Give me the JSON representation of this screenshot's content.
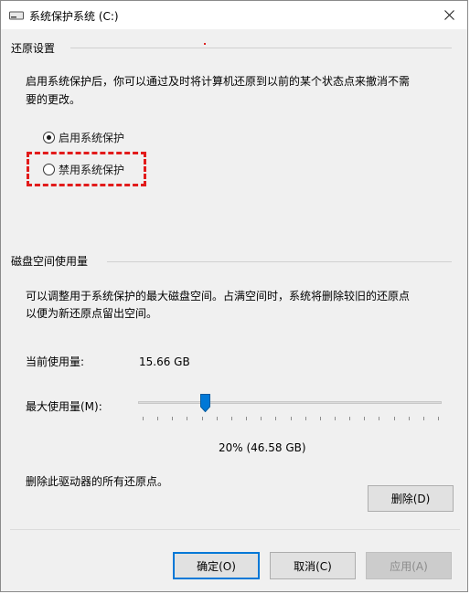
{
  "window": {
    "title": "系统保护系统 (C:)"
  },
  "restore_settings": {
    "group_label": "还原设置",
    "description_line1": "启用系统保护后，你可以通过及时将计算机还原到以前的某个状态点来撤消不需",
    "description_line2": "要的更改。",
    "options": [
      {
        "label": "启用系统保护",
        "selected": true
      },
      {
        "label": "禁用系统保护",
        "selected": false
      }
    ]
  },
  "disk_usage": {
    "group_label": "磁盘空间使用量",
    "description_line1": "可以调整用于系统保护的最大磁盘空间。占满空间时，系统将删除较旧的还原点",
    "description_line2": "以便为新还原点留出空间。",
    "current_label": "当前使用量:",
    "current_value": "15.66 GB",
    "max_label": "最大使用量(M):",
    "max_fraction": 0.2,
    "max_value_text": "20% (46.58 GB)",
    "delete_text": "删除此驱动器的所有还原点。",
    "delete_button": "删除(D)"
  },
  "footer": {
    "ok": "确定(O)",
    "cancel": "取消(C)",
    "apply": "应用(A)"
  },
  "colors": {
    "accent": "#0078d7",
    "highlight": "#e21b1b"
  }
}
